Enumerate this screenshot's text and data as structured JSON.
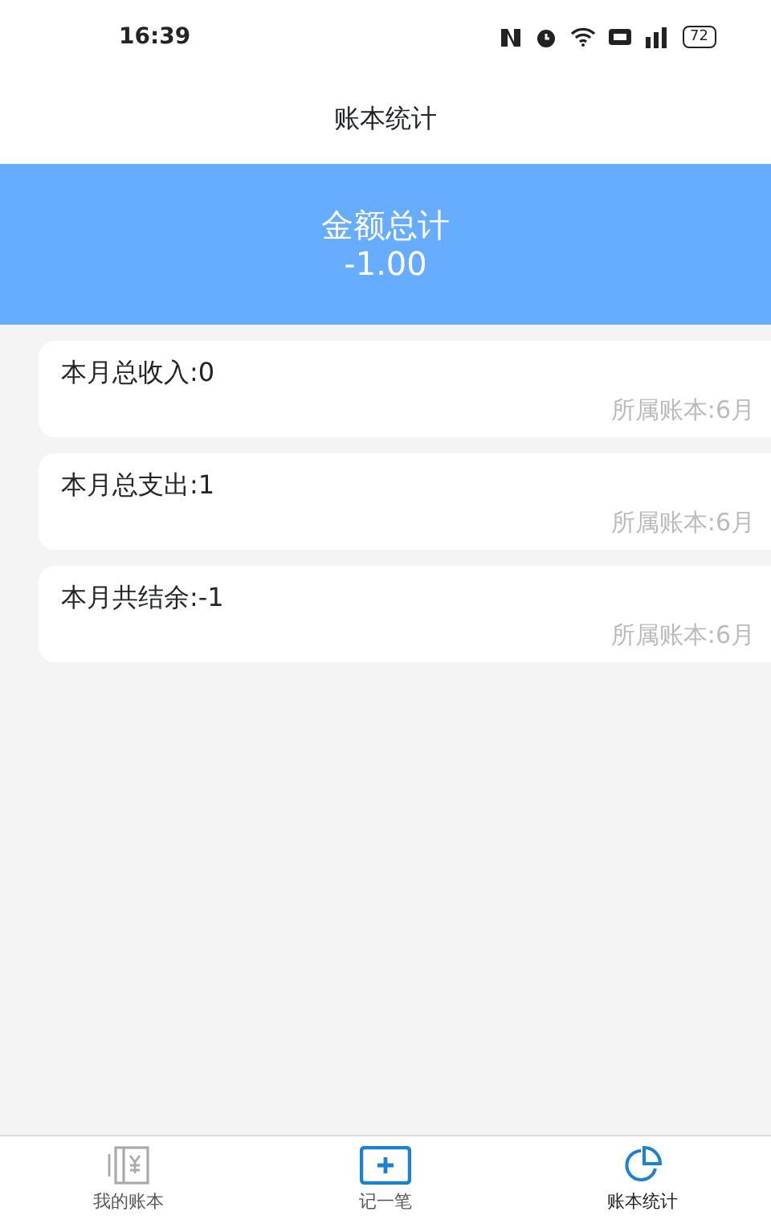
{
  "status_bar": {
    "time": "16:39",
    "battery": "72"
  },
  "title": "账本统计",
  "summary": {
    "label": "金额总计",
    "amount": "-1.00"
  },
  "entries": [
    {
      "text": "本月总收入:0",
      "book": "所属账本:6月"
    },
    {
      "text": "本月总支出:1",
      "book": "所属账本:6月"
    },
    {
      "text": "本月共结余:-1",
      "book": "所属账本:6月"
    }
  ],
  "tabs": [
    {
      "kind": "book",
      "label": "我的账本",
      "selected": false
    },
    {
      "kind": "add",
      "label": "记一笔",
      "selected": false
    },
    {
      "kind": "chart",
      "label": "账本统计",
      "selected": true
    }
  ]
}
